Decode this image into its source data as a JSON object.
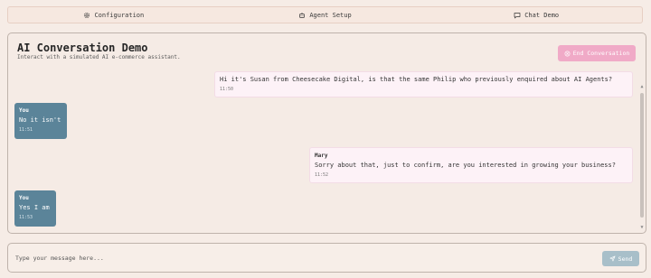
{
  "tabs": [
    {
      "label": "Configuration",
      "icon": "gear-icon"
    },
    {
      "label": "Agent Setup",
      "icon": "bot-icon"
    },
    {
      "label": "Chat Demo",
      "icon": "chat-icon"
    }
  ],
  "header": {
    "title": "AI Conversation Demo",
    "subtitle": "Interact with a simulated AI e-commerce assistant.",
    "end_button": "End Conversation"
  },
  "messages": [
    {
      "role": "agent",
      "sender": "",
      "text": "Hi it's Susan from Cheesecake Digital, is that the same Philip who previously enquired about AI Agents?",
      "time": "11:50"
    },
    {
      "role": "user",
      "sender": "You",
      "text": "No it isn't",
      "time": "11:51"
    },
    {
      "role": "agent",
      "sender": "Mary",
      "text": "Sorry about that, just to confirm, are you interested in growing your business?",
      "time": "11:52"
    },
    {
      "role": "user",
      "sender": "You",
      "text": "Yes I am",
      "time": "11:53"
    }
  ],
  "composer": {
    "placeholder": "Type your message here...",
    "value": "",
    "send_label": "Send"
  },
  "colors": {
    "accent_pink": "#f0aac7",
    "user_bubble": "#5b8499",
    "send_disabled": "#a8bfc9"
  }
}
